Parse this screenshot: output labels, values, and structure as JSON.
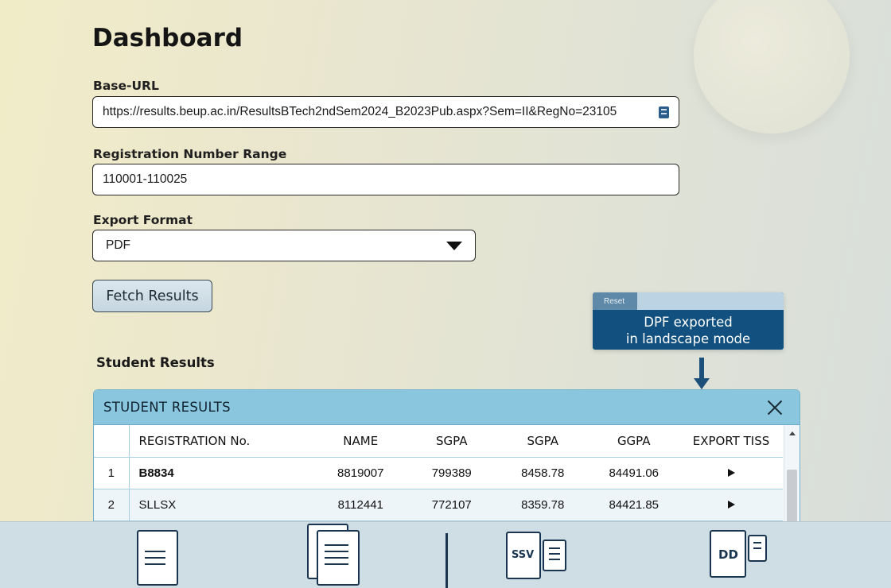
{
  "page": {
    "title": "Dashboard"
  },
  "form": {
    "base_url": {
      "label": "Base-URL",
      "value": "https://results.beup.ac.in/ResultsBTech2ndSem2024_B2023Pub.aspx?Sem=II&RegNo=23105"
    },
    "reg_range": {
      "label": "Registration Number Range",
      "value": "110001-110025"
    },
    "export_format": {
      "label": "Export Format",
      "selected": "PDF"
    },
    "fetch_label": "Fetch Results"
  },
  "toast": {
    "tag": "Reset",
    "message_line1": "DPF exported",
    "message_line2": "in landscape mode"
  },
  "results": {
    "section_heading": "Student Results",
    "panel_title": "STUDENT RESULTS",
    "columns": [
      "REGISTRATION No.",
      "NAME",
      "SGPA",
      "SGPA",
      "GGPA",
      "EXPORT TISS"
    ],
    "rows": [
      {
        "index": "1",
        "reg": "B8834",
        "name": "8819007",
        "sgpa1": "799389",
        "sgpa2": "8458.78",
        "cgpa": "84491.06"
      },
      {
        "index": "2",
        "reg": "SLLSX",
        "name": "8112441",
        "sgpa1": "772107",
        "sgpa2": "8359.78",
        "cgpa": "84421.85"
      }
    ]
  },
  "toolbar": {
    "items": [
      {
        "icon": "document-icon"
      },
      {
        "icon": "documents-icon"
      },
      {
        "icon": "csv-export-icon",
        "badge": "SSV"
      },
      {
        "icon": "pdf-export-icon",
        "badge": "DD"
      }
    ]
  },
  "colors": {
    "accent": "#11507f",
    "panel_header": "#8ac7de",
    "icon_ink": "#1a3550"
  }
}
